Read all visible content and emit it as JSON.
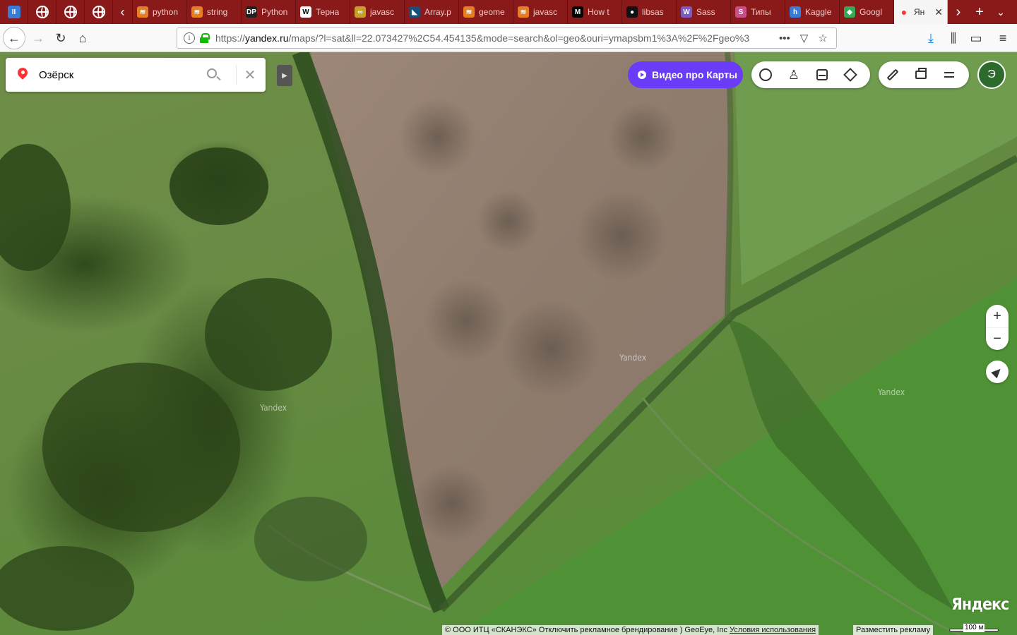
{
  "browser": {
    "tabs": [
      {
        "title": "python",
        "fav_color": "#e67e22",
        "fav": "≋"
      },
      {
        "title": "string",
        "fav_color": "#e67e22",
        "fav": "≋"
      },
      {
        "title": "Python",
        "fav_color": "#222222",
        "fav": "DP"
      },
      {
        "title": "Терна",
        "fav_color": "#ffffff",
        "fav": "W"
      },
      {
        "title": "javasc",
        "fav_color": "#c8a028",
        "fav": "∞"
      },
      {
        "title": "Array.p",
        "fav_color": "#1a4d7a",
        "fav": "◣"
      },
      {
        "title": "geome",
        "fav_color": "#e67e22",
        "fav": "≋"
      },
      {
        "title": "javasc",
        "fav_color": "#e67e22",
        "fav": "≋"
      },
      {
        "title": "How t",
        "fav_color": "#000000",
        "fav": "M"
      },
      {
        "title": "libsas",
        "fav_color": "#111111",
        "fav": "●"
      },
      {
        "title": "Sass",
        "fav_color": "#7a5bbf",
        "fav": "W"
      },
      {
        "title": "Типы",
        "fav_color": "#c94f8a",
        "fav": "S"
      },
      {
        "title": "Kaggle",
        "fav_color": "#3a7bd5",
        "fav": "h"
      },
      {
        "title": "Googl",
        "fav_color": "#34a853",
        "fav": "◆"
      }
    ],
    "active_tab": {
      "title": "Ян",
      "fav_color": "#ff3333"
    },
    "url_prefix": "https://",
    "url_host": "yandex.ru",
    "url_rest": "/maps/?l=sat&ll=22.073427%2C54.454135&mode=search&ol=geo&ouri=ymapsbm1%3A%2F%2Fgeo%3"
  },
  "map": {
    "search_value": "Озёрск",
    "promo_label": "Видео про Карты",
    "avatar_letter": "Э",
    "watermark": "Yandex",
    "logo": "Яндекс",
    "copyright_text": "© ООО ИТЦ «СКАНЭКС» Отключить рекламное брендирование ) GeoEye, Inc",
    "terms_link": "Условия использования",
    "ads_link": "Разместить рекламу",
    "scale_label": "100 м",
    "zoom_in": "+",
    "zoom_out": "−"
  }
}
